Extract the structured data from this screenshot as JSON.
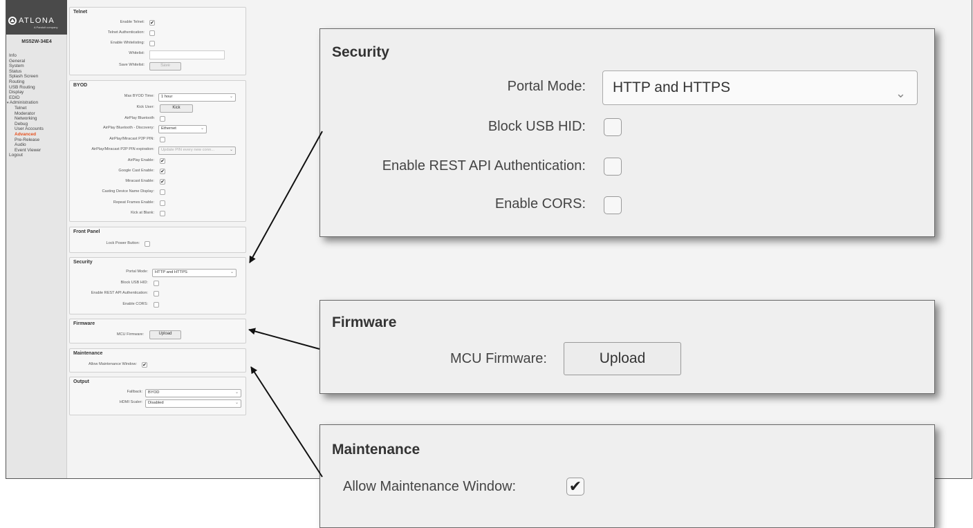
{
  "sidebar": {
    "logo_text": "ATLONA",
    "logo_sub": "A Panduit company",
    "model": "MS52W-34E4",
    "items": [
      {
        "label": "Info",
        "sub": false
      },
      {
        "label": "General",
        "sub": false
      },
      {
        "label": "System",
        "sub": false
      },
      {
        "label": "Status",
        "sub": false
      },
      {
        "label": "Splash Screen",
        "sub": false
      },
      {
        "label": "Routing",
        "sub": false
      },
      {
        "label": "USB Routing",
        "sub": false
      },
      {
        "label": "Display",
        "sub": false
      },
      {
        "label": "EDID",
        "sub": false
      },
      {
        "label": "Administration",
        "sub": false,
        "expanded": true
      },
      {
        "label": "Telnet",
        "sub": true
      },
      {
        "label": "Moderator",
        "sub": true
      },
      {
        "label": "Networking",
        "sub": true
      },
      {
        "label": "Debug",
        "sub": true
      },
      {
        "label": "User Accounts",
        "sub": true
      },
      {
        "label": "Advanced",
        "sub": true,
        "active": true
      },
      {
        "label": "Pre-Release",
        "sub": true
      },
      {
        "label": "Audio",
        "sub": true
      },
      {
        "label": "Event Viewer",
        "sub": true
      },
      {
        "label": "Logout",
        "sub": false
      }
    ]
  },
  "telnet": {
    "title": "Telnet",
    "enable_label": "Enable Telnet:",
    "enable_checked": true,
    "auth_label": "Telnet Authentication:",
    "auth_checked": false,
    "whitelisting_label": "Enable Whitelisting:",
    "whitelisting_checked": false,
    "whitelist_label": "Whitelist:",
    "whitelist_value": "",
    "save_label": "Save Whitelist:",
    "save_button": "Save"
  },
  "byod": {
    "title": "BYOD",
    "max_time_label": "Max BYOD Time:",
    "max_time_value": "1 hour",
    "kick_user_label": "Kick User:",
    "kick_button": "Kick",
    "airplay_bt_label": "AirPlay Bluetooth",
    "airplay_bt_checked": false,
    "airplay_bt_disc_label": "AirPlay Bluetooth - Discovery:",
    "airplay_bt_disc_value": "Ethernet",
    "p2p_pin_label": "AirPlay/Miracast P2P PIN:",
    "p2p_pin_checked": false,
    "p2p_exp_label": "AirPlay/Miracast P2P PIN expiration:",
    "p2p_exp_value": "Update PIN every new conn...",
    "airplay_enable_label": "AirPlay Enable:",
    "airplay_enable_checked": true,
    "gcast_label": "Google Cast Enable:",
    "gcast_checked": true,
    "miracast_label": "Miracast Enable:",
    "miracast_checked": true,
    "casting_name_label": "Casting Device Name Display:",
    "casting_name_checked": false,
    "repeat_label": "Repeat Frames Enable:",
    "repeat_checked": false,
    "kick_blank_label": "Kick at Blank:",
    "kick_blank_checked": false
  },
  "front_panel": {
    "title": "Front Panel",
    "lock_label": "Lock Power Button:",
    "lock_checked": false
  },
  "security": {
    "title": "Security",
    "portal_label": "Portal Mode:",
    "portal_value": "HTTP and HTTPS",
    "block_usb_label": "Block USB HID:",
    "block_usb_checked": false,
    "rest_label": "Enable REST API Authentication:",
    "rest_checked": false,
    "cors_label": "Enable CORS:",
    "cors_checked": false
  },
  "firmware": {
    "title": "Firmware",
    "mcu_label": "MCU Firmware:",
    "upload_button": "Upload"
  },
  "maintenance": {
    "title": "Maintenance",
    "allow_label": "Allow Maintenance Window:",
    "allow_checked": true
  },
  "output": {
    "title": "Output",
    "fallback_label": "Fallback:",
    "fallback_value": "BYOD",
    "scaler_label": "HDMI Scaler:",
    "scaler_value": "Disabled"
  },
  "icons": {
    "check": "✔",
    "chevron": "⌄"
  }
}
